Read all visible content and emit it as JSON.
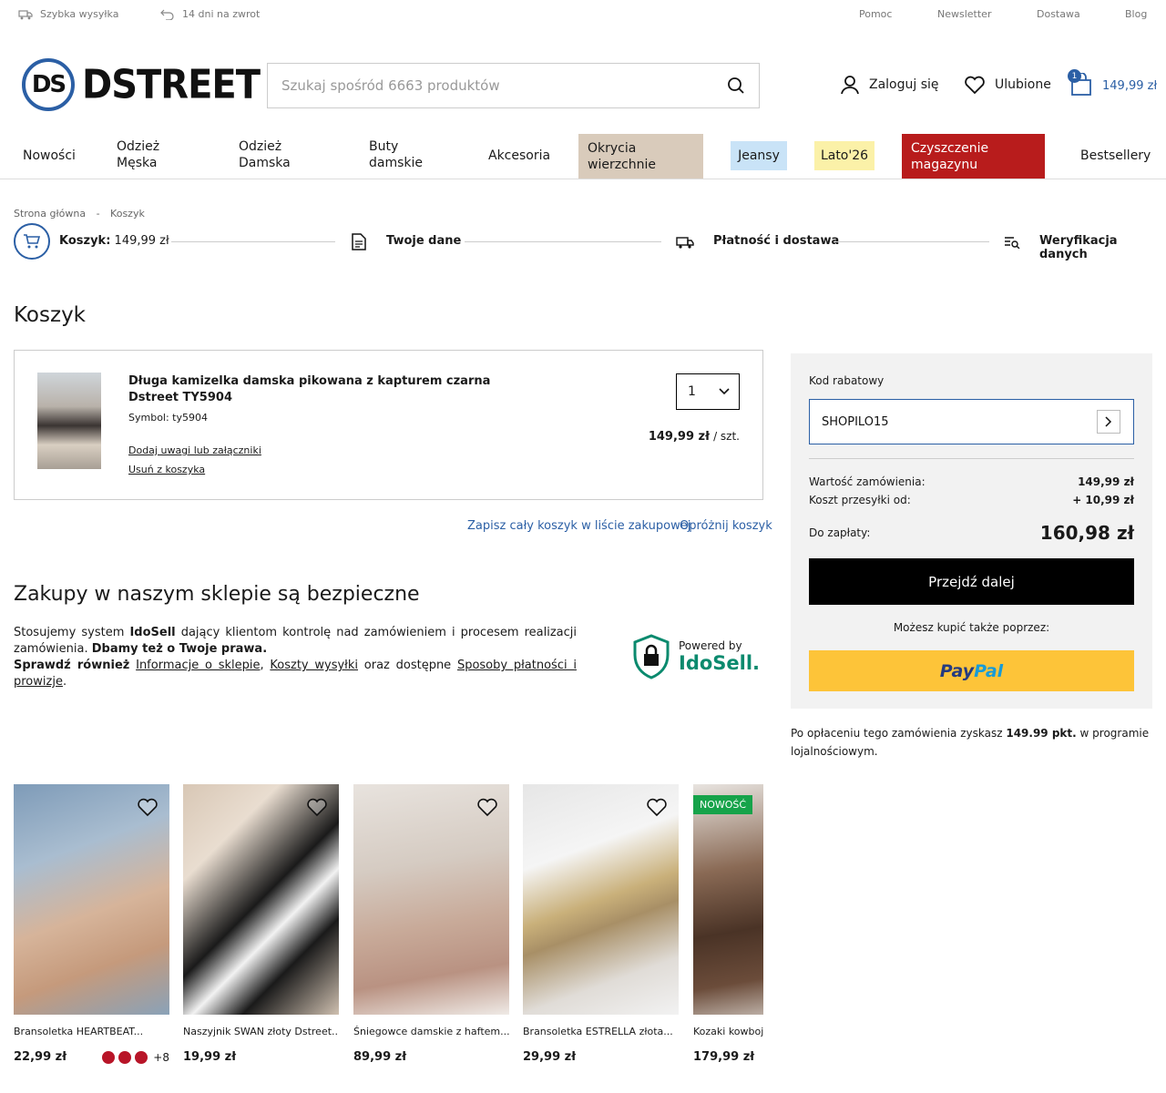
{
  "topbar": {
    "left": [
      {
        "icon": "truck-icon",
        "label": "Szybka wysyłka"
      },
      {
        "icon": "return-arrow-icon",
        "label": "14 dni na zwrot"
      }
    ],
    "right": [
      "Pomoc",
      "Newsletter",
      "Dostawa",
      "Blog"
    ]
  },
  "brand": {
    "logo_text": "DSTREET",
    "accent": "#2b5fa5"
  },
  "search": {
    "placeholder": "Szukaj spośród 6663 produktów"
  },
  "header": {
    "login": "Zaloguj się",
    "favorites": "Ulubione",
    "cart_count": "1",
    "cart_total": "149,99 zł"
  },
  "nav": [
    {
      "label": "Nowości",
      "bg": ""
    },
    {
      "label": "Odzież Męska",
      "bg": ""
    },
    {
      "label": "Odzież Damska",
      "bg": ""
    },
    {
      "label": "Buty damskie",
      "bg": ""
    },
    {
      "label": "Akcesoria",
      "bg": ""
    },
    {
      "label": "Okrycia wierzchnie",
      "bg": "#d9cbbb"
    },
    {
      "label": "Jeansy",
      "bg": "#c9e3f7"
    },
    {
      "label": "Lato'26",
      "bg": "#fbf1a8"
    },
    {
      "label": "Czyszczenie magazynu",
      "bg": "#b81c1c"
    },
    {
      "label": "Bestsellery",
      "bg": ""
    }
  ],
  "breadcrumb": {
    "home": "Strona główna",
    "sep": "-",
    "current": "Koszyk"
  },
  "steps": {
    "cart_label": "Koszyk:",
    "cart_value": "149,99 zł",
    "data": "Twoje dane",
    "payment": "Płatność i dostawa",
    "verify": "Weryfikacja danych"
  },
  "page_title": "Koszyk",
  "cart_item": {
    "name": "Długa kamizelka damska pikowana z kapturem czarna Dstreet TY5904",
    "symbol": "Symbol: ty5904",
    "add_note": "Dodaj uwagi lub załączniki",
    "remove": "Usuń z koszyka",
    "qty": "1",
    "price": "149,99 zł",
    "unit": "/ szt."
  },
  "cart_links": {
    "save": "Zapisz cały koszyk w liście zakupowej",
    "empty": "Opróżnij koszyk"
  },
  "safe": {
    "title": "Zakupy w naszym sklepie są bezpieczne",
    "p1a": "Stosujemy system",
    "p1b": "IdoSell",
    "p1c": "dający klientom kontrolę nad zamówieniem i procesem realizacji zamówienia.",
    "p1d": "Dbamy też o Twoje prawa",
    "p2a": "Sprawdź również",
    "link1": "Informacje o sklepie",
    "link2": "Koszty wysyłki",
    "p2b": "oraz dostępne",
    "link3": "Sposoby płatności i prowizje",
    "powered": "Powered by",
    "ido": "IdoSell."
  },
  "summary": {
    "coupon_label": "Kod rabatowy",
    "coupon_value": "SHOPILO15",
    "order_value_label": "Wartość zamówienia:",
    "order_value": "149,99 zł",
    "shipping_label": "Koszt przesyłki od:",
    "shipping": "+ 10,99 zł",
    "to_pay_label": "Do zapłaty:",
    "to_pay": "160,98 zł",
    "next": "Przejdź dalej",
    "also": "Możesz kupić także poprzez:",
    "paypal_a": "Pay",
    "paypal_b": "Pal"
  },
  "loyalty": {
    "a": "Po opłaceniu tego zamówienia zyskasz",
    "b": "149.99 pkt.",
    "c": "w programie lojalnościowym."
  },
  "products": [
    {
      "name": "Bransoletka HEARTBEAT...",
      "price": "22,99 zł",
      "more": "+8"
    },
    {
      "name": "Naszyjnik SWAN złoty Dstreet...",
      "price": "19,99 zł"
    },
    {
      "name": "Śniegowce damskie z haftem...",
      "price": "89,99 zł"
    },
    {
      "name": "Bransoletka ESTRELLA złota...",
      "price": "29,99 zł"
    },
    {
      "name": "Kozaki kowboj",
      "price": "179,99 zł",
      "badge": "NOWOŚĆ"
    }
  ]
}
